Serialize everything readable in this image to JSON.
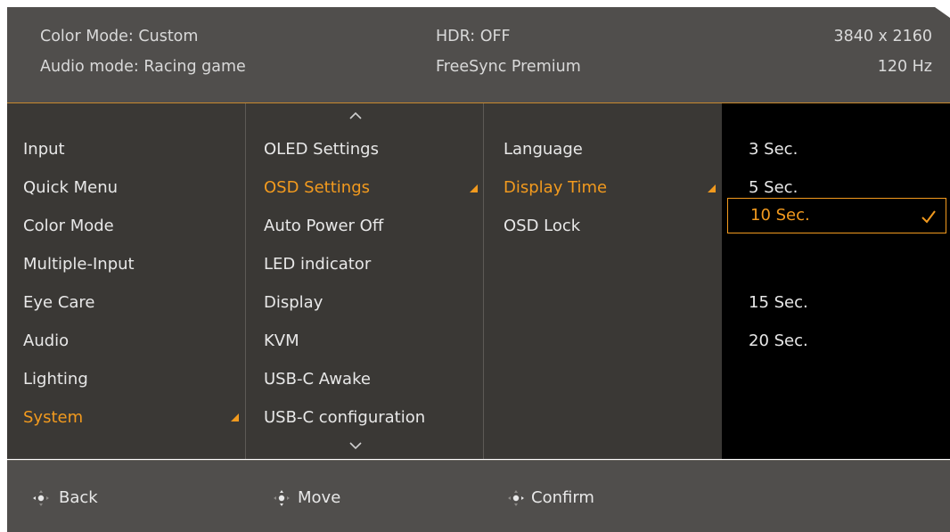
{
  "header": {
    "color_mode": "Color Mode: Custom",
    "audio_mode": "Audio mode: Racing game",
    "hdr": "HDR: OFF",
    "freesync": "FreeSync Premium",
    "resolution": "3840 x 2160",
    "refresh_rate": "120 Hz"
  },
  "main_menu": {
    "items": [
      "Input",
      "Quick Menu",
      "Color Mode",
      "Multiple-Input",
      "Eye Care",
      "Audio",
      "Lighting",
      "System"
    ],
    "selected_index": 7
  },
  "system_menu": {
    "items": [
      "OLED Settings",
      "OSD Settings",
      "Auto Power Off",
      "LED indicator",
      "Display",
      "KVM",
      "USB-C Awake",
      "USB-C configuration"
    ],
    "selected_index": 1
  },
  "osd_menu": {
    "items": [
      "Language",
      "Display Time",
      "OSD Lock"
    ],
    "selected_index": 1
  },
  "display_time_options": {
    "items": [
      "3 Sec.",
      "5 Sec.",
      "10 Sec.",
      "15 Sec.",
      "20 Sec."
    ],
    "highlighted_index": 2,
    "checked_index": 2
  },
  "footer": {
    "back": "Back",
    "move": "Move",
    "confirm": "Confirm"
  },
  "colors": {
    "accent": "#f29a1e",
    "panel": "#3a3835",
    "bar": "#504e4c"
  }
}
